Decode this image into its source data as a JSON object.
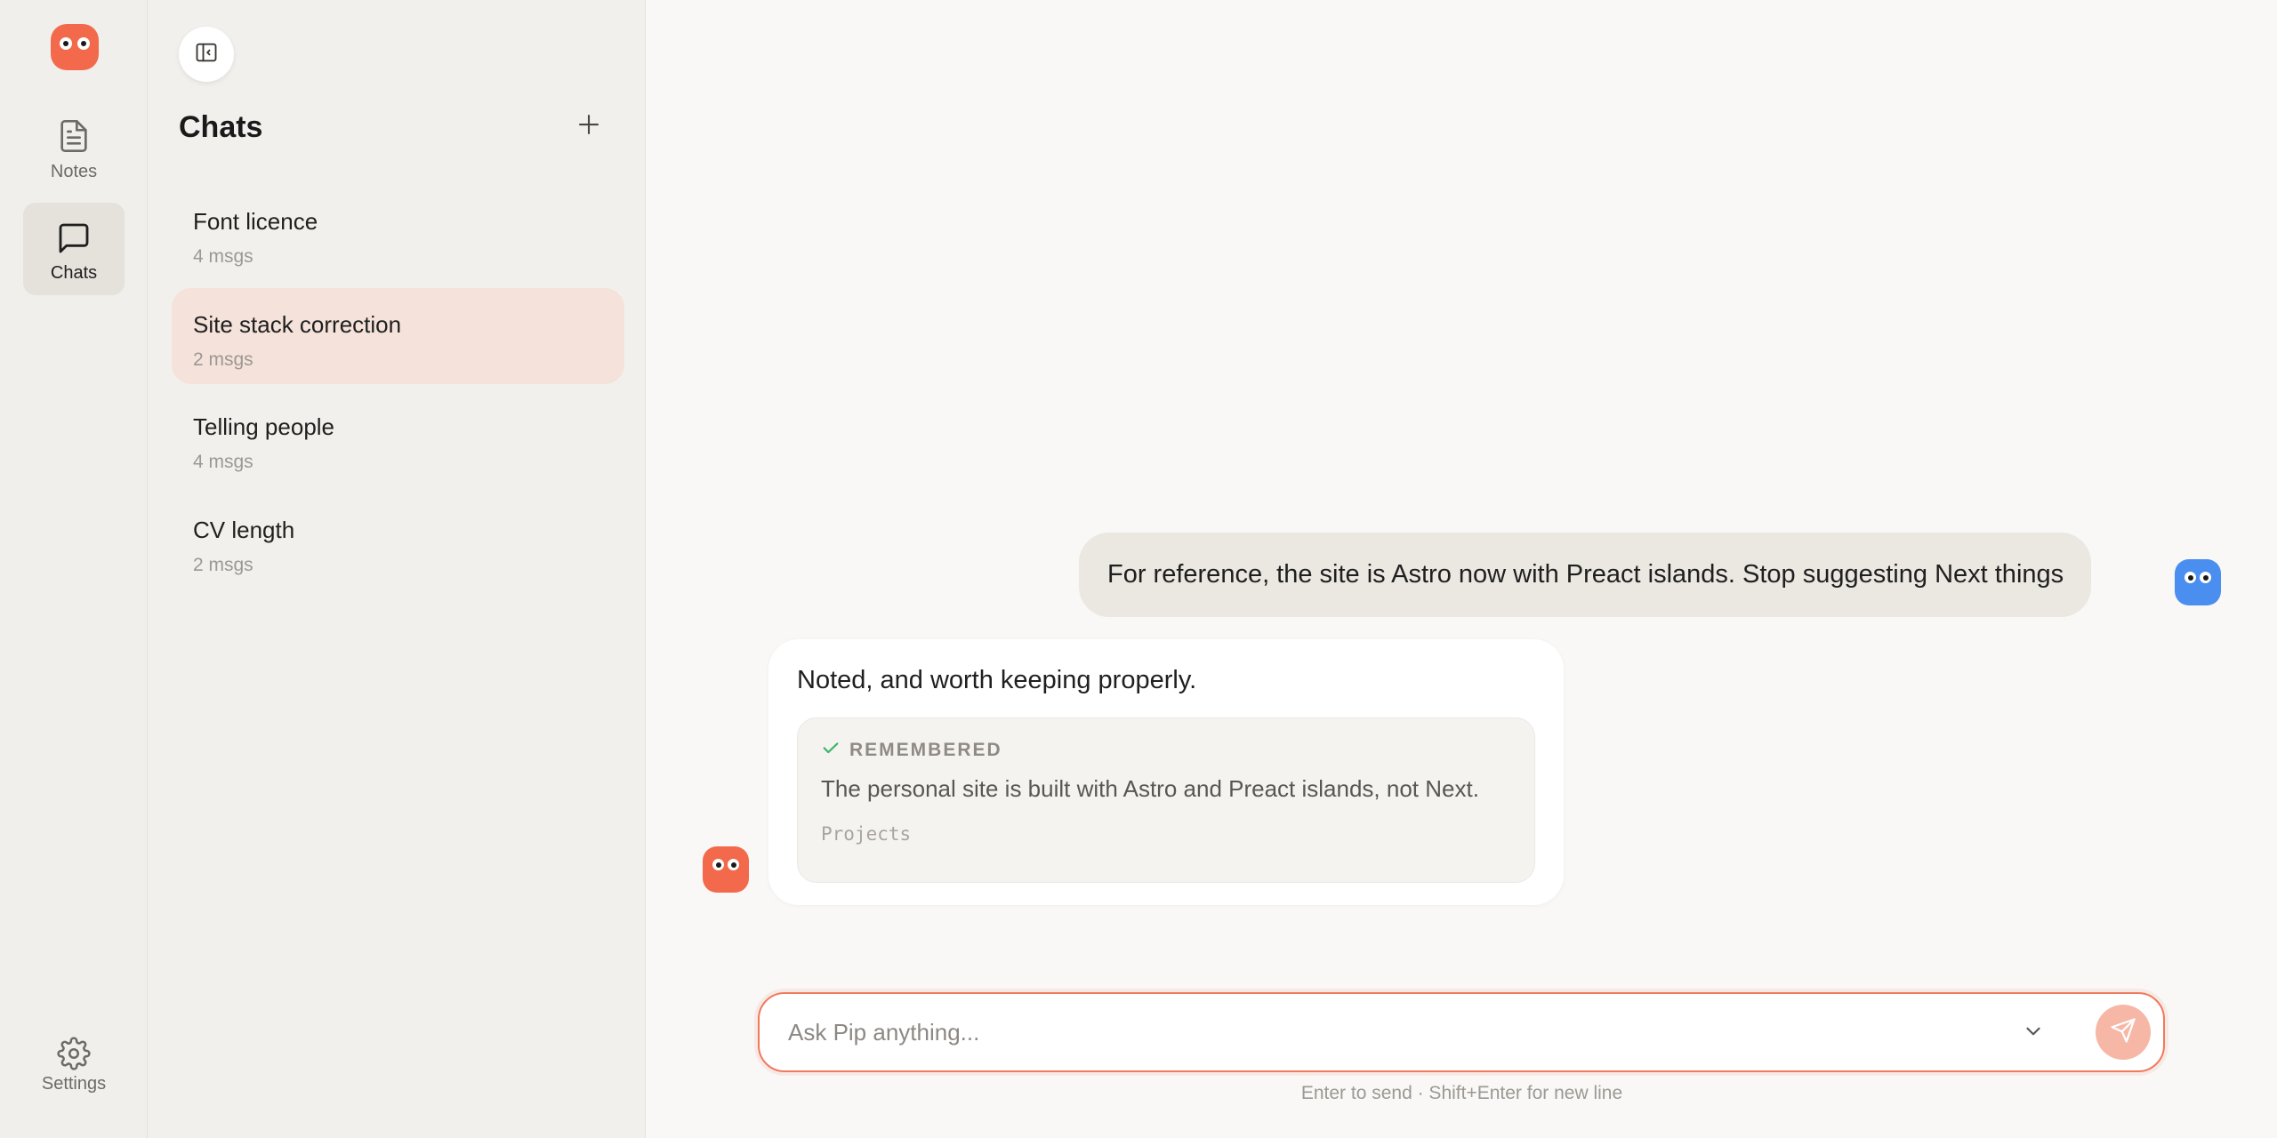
{
  "rail": {
    "logo_icon": "pip-owl-logo",
    "items": [
      {
        "label": "Notes",
        "icon": "document-icon"
      },
      {
        "label": "Chats",
        "icon": "chat-bubble-icon",
        "active": true
      }
    ],
    "settings_label": "Settings"
  },
  "panel": {
    "title": "Chats",
    "chats": [
      {
        "title": "Font licence",
        "meta": "4 msgs"
      },
      {
        "title": "Site stack correction",
        "meta": "2 msgs",
        "active": true
      },
      {
        "title": "Telling people",
        "meta": "4 msgs"
      },
      {
        "title": "CV length",
        "meta": "2 msgs"
      }
    ]
  },
  "conversation": {
    "user_message": "For reference, the site is Astro now with Preact islands. Stop suggesting Next things",
    "assistant_message": "Noted, and worth keeping properly.",
    "memory": {
      "label": "REMEMBERED",
      "text": "The personal site is built with Astro and Preact islands, not Next.",
      "category": "Projects"
    }
  },
  "composer": {
    "placeholder": "Ask Pip anything...",
    "value": "",
    "hint": "Enter to send · Shift+Enter for new line"
  },
  "colors": {
    "accent": "#f26a4b",
    "user_avatar": "#4a8ef0",
    "active_chat_bg": "#f4e2db",
    "send_button": "#f6b7a7",
    "remembered_check": "#3fb56b"
  }
}
